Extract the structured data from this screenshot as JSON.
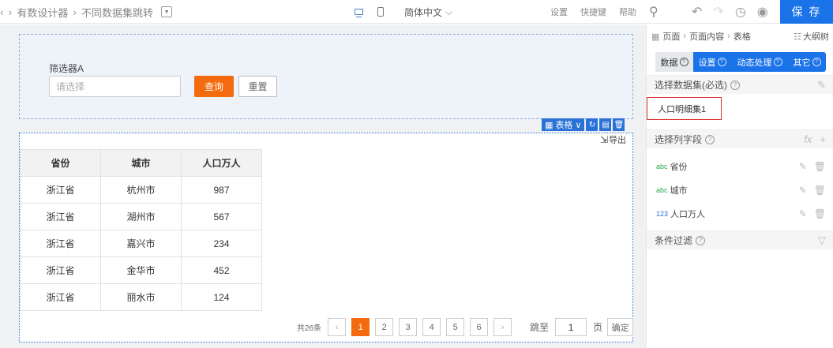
{
  "topbar": {
    "breadcrumb": [
      "有数设计器",
      "不同数据集跳转"
    ],
    "language": "简体中文",
    "links": [
      "设置",
      "快捷键",
      "帮助"
    ],
    "save_label": "保 存"
  },
  "filter": {
    "label": "筛选器A",
    "placeholder": "请选择",
    "query_label": "查询",
    "reset_label": "重置"
  },
  "component_toolbar": {
    "type_label": "表格"
  },
  "export_label": "导出",
  "table": {
    "headers": [
      "省份",
      "城市",
      "人口万人"
    ],
    "rows": [
      [
        "浙江省",
        "杭州市",
        "987"
      ],
      [
        "浙江省",
        "湖州市",
        "567"
      ],
      [
        "浙江省",
        "嘉兴市",
        "234"
      ],
      [
        "浙江省",
        "金华市",
        "452"
      ],
      [
        "浙江省",
        "丽水市",
        "124"
      ]
    ]
  },
  "pager": {
    "total": "共26条",
    "pages": [
      "1",
      "2",
      "3",
      "4",
      "5",
      "6"
    ],
    "current": "1",
    "goto_label": "跳至",
    "goto_value": "1",
    "unit": "页",
    "confirm": "确定"
  },
  "panel": {
    "breadcrumb": [
      "页面",
      "页面内容",
      "表格"
    ],
    "outline_label": "大纲树",
    "tabs": [
      "数据",
      "设置",
      "动态处理",
      "其它"
    ],
    "active_tab": "数据",
    "dataset_section": "选择数据集(必选)",
    "dataset_value": "人口明细集1",
    "fields_section": "选择列字段",
    "fields": [
      {
        "type": "abc",
        "name": "省份"
      },
      {
        "type": "abc",
        "name": "城市"
      },
      {
        "type": "123",
        "name": "人口万人"
      }
    ],
    "filter_section": "条件过滤"
  },
  "colors": {
    "accent": "#1a73e8",
    "primary_orange": "#f46a0e",
    "selection_blue": "#2a72d6"
  }
}
